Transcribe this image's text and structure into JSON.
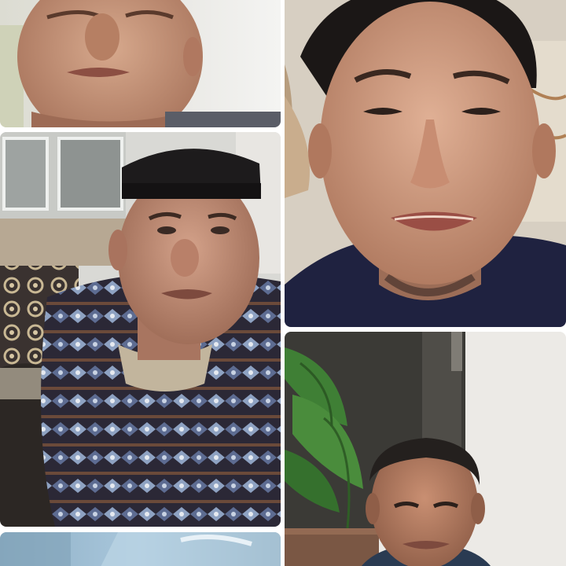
{
  "call": {
    "participants": [
      {
        "id": "p1",
        "video": "on"
      },
      {
        "id": "p2",
        "video": "on"
      },
      {
        "id": "p3",
        "video": "on"
      },
      {
        "id": "p4",
        "video": "on"
      },
      {
        "id": "p5",
        "video": "on"
      }
    ]
  },
  "colors": {
    "background": "#ffffff",
    "skin": "#c99a7f",
    "skin_shadow": "#a4735a",
    "hat": "#1d1b1c",
    "batik_dark": "#2a2630",
    "batik_light": "#9fb0c8",
    "shirt_navy": "#1f2240",
    "plant_green": "#3d7a34",
    "wall_light": "#eceae6"
  }
}
